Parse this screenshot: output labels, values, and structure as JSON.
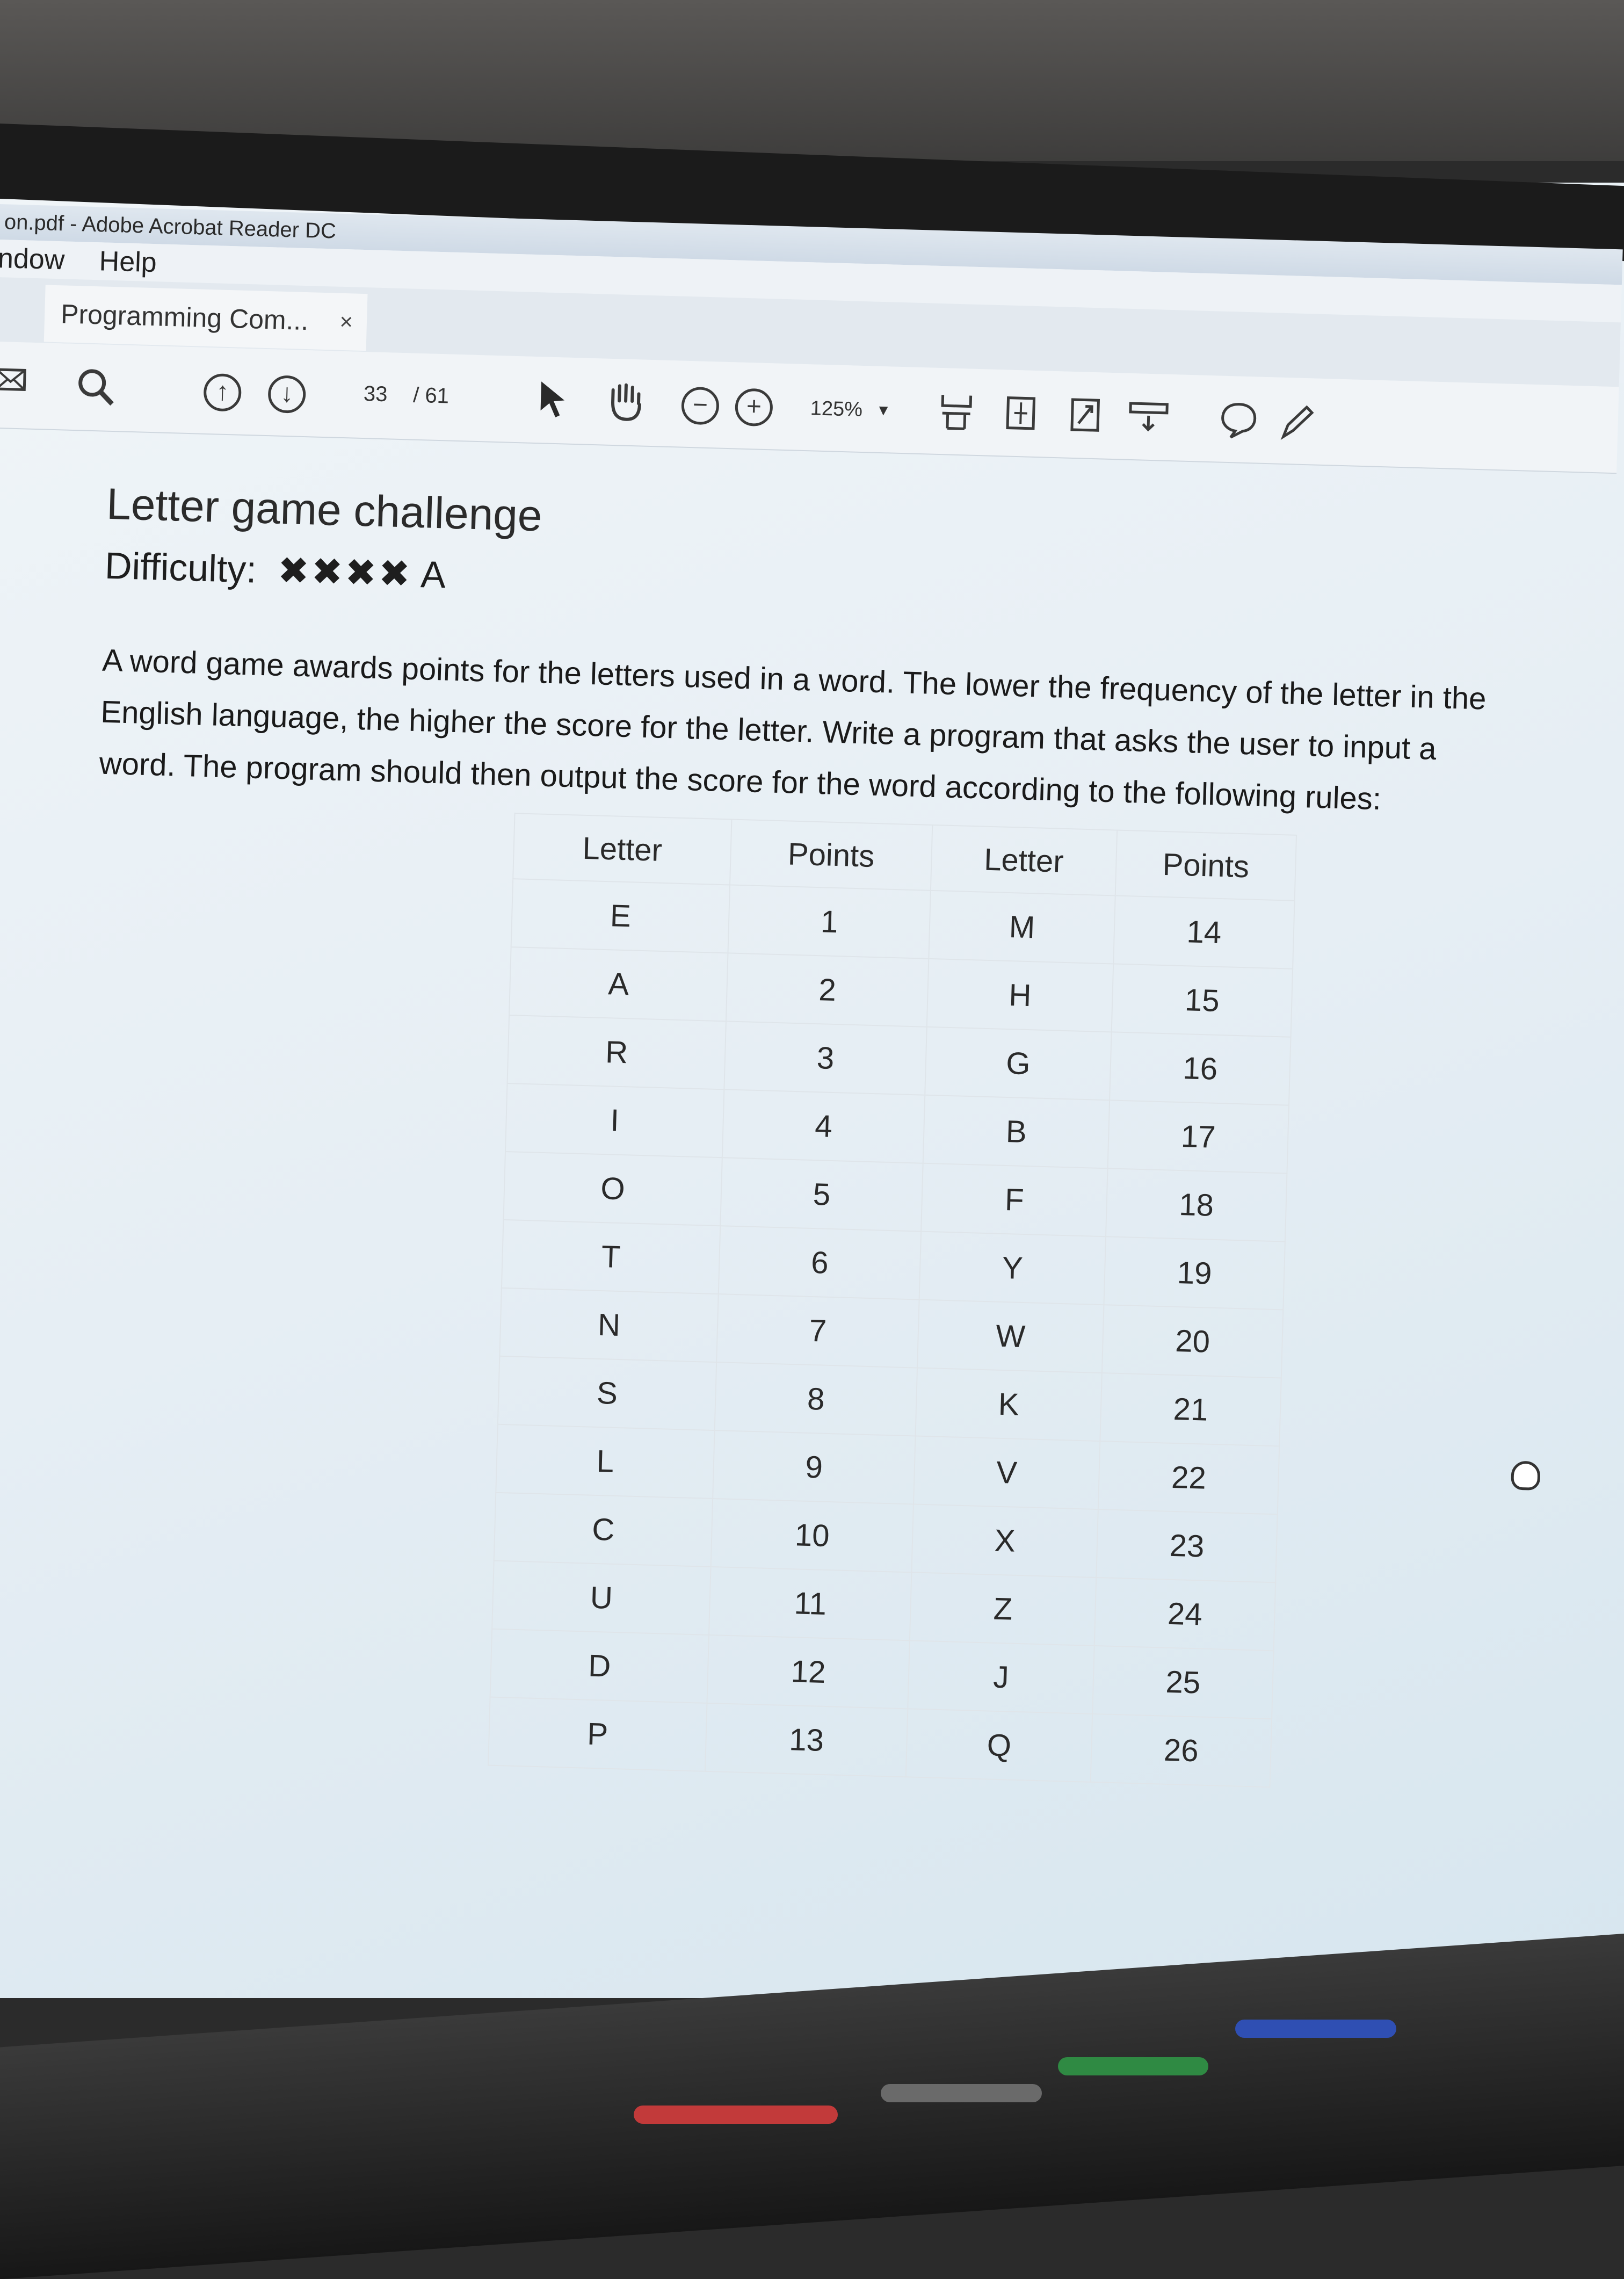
{
  "window": {
    "title": "on.pdf - Adobe Acrobat Reader DC"
  },
  "menu": [
    "ndow",
    "Help"
  ],
  "tab": {
    "label": "Programming Com...",
    "close": "×"
  },
  "toolbar": {
    "page_current": "33",
    "page_total": "/ 61",
    "zoom": "125%",
    "icons": [
      "mail-icon",
      "search-icon",
      "page-up-icon",
      "page-down-icon",
      "select-cursor-icon",
      "hand-tool-icon",
      "zoom-out-icon",
      "zoom-in-icon",
      "fit-width-icon",
      "fit-page-icon",
      "full-screen-icon",
      "read-mode-icon",
      "comment-icon",
      "pen-icon"
    ]
  },
  "document": {
    "title": "Letter game challenge",
    "difficulty_label": "Difficulty:",
    "difficulty_stars": "✖✖✖✖",
    "difficulty_grade": "A",
    "paragraph": "A word game awards points for the letters used in a word.  The lower the frequency of the letter in the English language, the higher the score for the letter.  Write a program that asks the user to input a word.  The program should then output the score for the word according to the following rules:",
    "table": {
      "headers": [
        "Letter",
        "Points",
        "Letter",
        "Points"
      ],
      "rows": [
        [
          "E",
          "1",
          "M",
          "14"
        ],
        [
          "A",
          "2",
          "H",
          "15"
        ],
        [
          "R",
          "3",
          "G",
          "16"
        ],
        [
          "I",
          "4",
          "B",
          "17"
        ],
        [
          "O",
          "5",
          "F",
          "18"
        ],
        [
          "T",
          "6",
          "Y",
          "19"
        ],
        [
          "N",
          "7",
          "W",
          "20"
        ],
        [
          "S",
          "8",
          "K",
          "21"
        ],
        [
          "L",
          "9",
          "V",
          "22"
        ],
        [
          "C",
          "10",
          "X",
          "23"
        ],
        [
          "U",
          "11",
          "Z",
          "24"
        ],
        [
          "D",
          "12",
          "J",
          "25"
        ],
        [
          "P",
          "13",
          "Q",
          "26"
        ]
      ]
    }
  }
}
